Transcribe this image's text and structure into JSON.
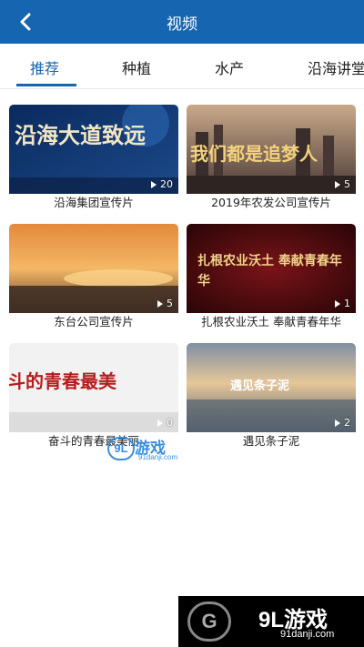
{
  "header": {
    "title": "视频",
    "back_icon": "chevron-left-icon"
  },
  "tabs": [
    {
      "label": "推荐",
      "active": true
    },
    {
      "label": "种植",
      "active": false
    },
    {
      "label": "水产",
      "active": false
    },
    {
      "label": "沿海讲堂",
      "active": false
    }
  ],
  "videos": [
    {
      "caption": "沿海集团宣传片",
      "count": "20",
      "overlay": "沿海大道致远"
    },
    {
      "caption": "2019年农发公司宣传片",
      "count": "5",
      "overlay": "我们都是追梦人"
    },
    {
      "caption": "东台公司宣传片",
      "count": "5",
      "overlay": ""
    },
    {
      "caption": "扎根农业沃土 奉献青春年华",
      "count": "1",
      "overlay": "扎根农业沃土 奉献青春年华"
    },
    {
      "caption": "奋斗的青春最美丽",
      "count": "0",
      "overlay": "斗的青春最美"
    },
    {
      "caption": "遇见条子泥",
      "count": "2",
      "overlay": "遇见条子泥"
    }
  ],
  "watermarks": {
    "middle": {
      "badge": "9L",
      "main": "游戏",
      "sub": "91danji.com"
    },
    "bottom": {
      "badge": "G",
      "main": "9L游戏",
      "sub": "91danji.com"
    }
  },
  "colors": {
    "primary": "#1565b0",
    "text": "#222222",
    "divider": "#e4e4e4"
  }
}
